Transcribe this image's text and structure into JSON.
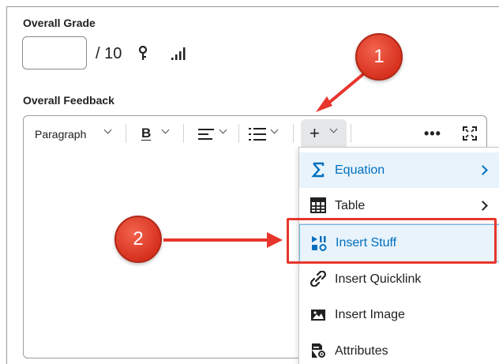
{
  "grade": {
    "label": "Overall Grade",
    "input_value": "",
    "out_of": "/ 10"
  },
  "feedback": {
    "label": "Overall Feedback",
    "toolbar": {
      "format_label": "Paragraph",
      "bold_label": "B",
      "insert_label": "+",
      "more_label": "•••"
    }
  },
  "insert_menu": {
    "items": [
      {
        "label": "Equation",
        "icon": "sigma-icon",
        "has_submenu": true
      },
      {
        "label": "Table",
        "icon": "table-icon",
        "has_submenu": true
      },
      {
        "label": "Insert Stuff",
        "icon": "insert-stuff-icon",
        "has_submenu": false
      },
      {
        "label": "Insert Quicklink",
        "icon": "link-icon",
        "has_submenu": false
      },
      {
        "label": "Insert Image",
        "icon": "image-icon",
        "has_submenu": false
      },
      {
        "label": "Attributes",
        "icon": "attributes-icon",
        "has_submenu": false
      }
    ]
  },
  "annotations": {
    "step1": "1",
    "step2": "2"
  },
  "colors": {
    "accent": "#006fbf",
    "menu_highlight": "#e8f3fb",
    "callout_red": "#e8352c"
  }
}
